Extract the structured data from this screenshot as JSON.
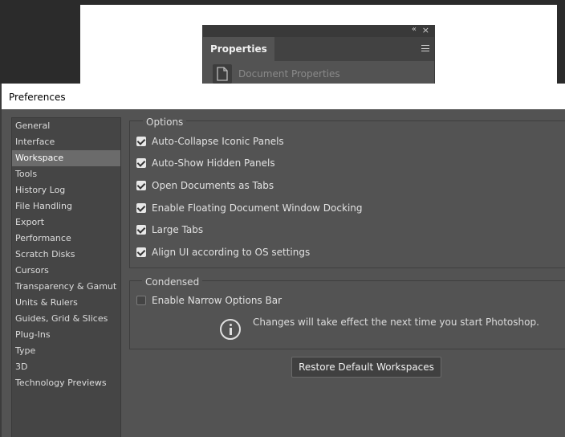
{
  "background": {
    "properties_panel": {
      "tab_label": "Properties",
      "collapse_glyph": "«",
      "close_glyph": "×",
      "document_properties_label": "Document Properties"
    }
  },
  "dialog": {
    "title": "Preferences",
    "sidebar": {
      "items": [
        {
          "label": "General",
          "active": false
        },
        {
          "label": "Interface",
          "active": false
        },
        {
          "label": "Workspace",
          "active": true
        },
        {
          "label": "Tools",
          "active": false
        },
        {
          "label": "History Log",
          "active": false
        },
        {
          "label": "File Handling",
          "active": false
        },
        {
          "label": "Export",
          "active": false
        },
        {
          "label": "Performance",
          "active": false
        },
        {
          "label": "Scratch Disks",
          "active": false
        },
        {
          "label": "Cursors",
          "active": false
        },
        {
          "label": "Transparency & Gamut",
          "active": false
        },
        {
          "label": "Units & Rulers",
          "active": false
        },
        {
          "label": "Guides, Grid & Slices",
          "active": false
        },
        {
          "label": "Plug-Ins",
          "active": false
        },
        {
          "label": "Type",
          "active": false
        },
        {
          "label": "3D",
          "active": false
        },
        {
          "label": "Technology Previews",
          "active": false
        }
      ]
    },
    "options": {
      "label": "Options",
      "items": [
        {
          "label": "Auto-Collapse Iconic Panels",
          "checked": true
        },
        {
          "label": "Auto-Show Hidden Panels",
          "checked": true
        },
        {
          "label": "Open Documents as Tabs",
          "checked": true
        },
        {
          "label": "Enable Floating Document Window Docking",
          "checked": true
        },
        {
          "label": "Large Tabs",
          "checked": true
        },
        {
          "label": "Align UI according to OS settings",
          "checked": true
        }
      ]
    },
    "condensed": {
      "label": "Condensed",
      "narrow_options_bar": {
        "label": "Enable Narrow Options Bar",
        "checked": false
      },
      "info_text": "Changes will take effect the next time you start Photoshop."
    },
    "restore_button_label": "Restore Default Workspaces"
  },
  "colors": {
    "dialog_bg": "#535353",
    "sidebar_bg": "#454545",
    "active_item_bg": "#6b6b6b"
  }
}
